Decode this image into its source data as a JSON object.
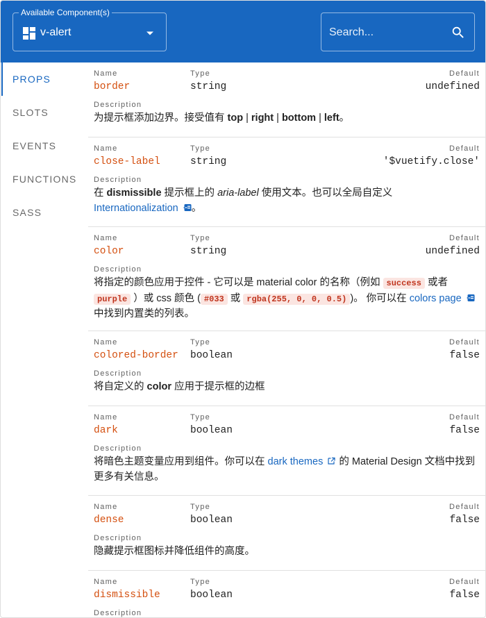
{
  "toolbar": {
    "component_select": {
      "legend": "Available Component(s)",
      "value": "v-alert",
      "icon": "view-dashboard-icon"
    },
    "search": {
      "placeholder": "Search...",
      "value": "",
      "icon": "search-icon"
    }
  },
  "tabs": [
    "PROPS",
    "SLOTS",
    "EVENTS",
    "FUNCTIONS",
    "SASS"
  ],
  "active_tab": "PROPS",
  "labels": {
    "name": "Name",
    "type": "Type",
    "default": "Default",
    "description": "Description"
  },
  "props": [
    {
      "name": "border",
      "type": "string",
      "default": "undefined",
      "description": [
        "为提示框添加边界。接受值有 ",
        {
          "b": "top"
        },
        " | ",
        {
          "b": "right"
        },
        " | ",
        {
          "b": "bottom"
        },
        " | ",
        {
          "b": "left"
        },
        "。"
      ]
    },
    {
      "name": "close-label",
      "type": "string",
      "default": "'$vuetify.close'",
      "description": [
        "在 ",
        {
          "b": "dismissible"
        },
        " 提示框上的 ",
        {
          "i": "aria-label"
        },
        " 使用文本。也可以全局自定义 ",
        {
          "a": "Internationalization",
          "icon": "page-link-icon"
        },
        "。"
      ]
    },
    {
      "name": "color",
      "type": "string",
      "default": "undefined",
      "description": [
        "将指定的颜色应用于控件 - 它可以是 material color 的名称（例如 ",
        {
          "code": "success"
        },
        " 或者 ",
        {
          "code": "purple"
        },
        " ）或 css 颜色 (",
        {
          "code": "#033"
        },
        " 或 ",
        {
          "code": "rgba(255, 0, 0, 0.5)"
        },
        ")。 你可以在 ",
        {
          "a": "colors page",
          "icon": "page-link-icon"
        },
        " 中找到内置类的列表。"
      ]
    },
    {
      "name": "colored-border",
      "type": "boolean",
      "default": "false",
      "description": [
        "将自定义的 ",
        {
          "b": "color"
        },
        " 应用于提示框的边框"
      ]
    },
    {
      "name": "dark",
      "type": "boolean",
      "default": "false",
      "description": [
        "将暗色主题变量应用到组件。你可以在 ",
        {
          "a": "dark themes",
          "icon": "open-in-new-icon"
        },
        " 的 Material Design 文档中找到更多有关信息。"
      ]
    },
    {
      "name": "dense",
      "type": "boolean",
      "default": "false",
      "description": [
        "隐藏提示框图标并降低组件的高度。"
      ]
    },
    {
      "name": "dismissible",
      "type": "boolean",
      "default": "false",
      "description": []
    }
  ]
}
